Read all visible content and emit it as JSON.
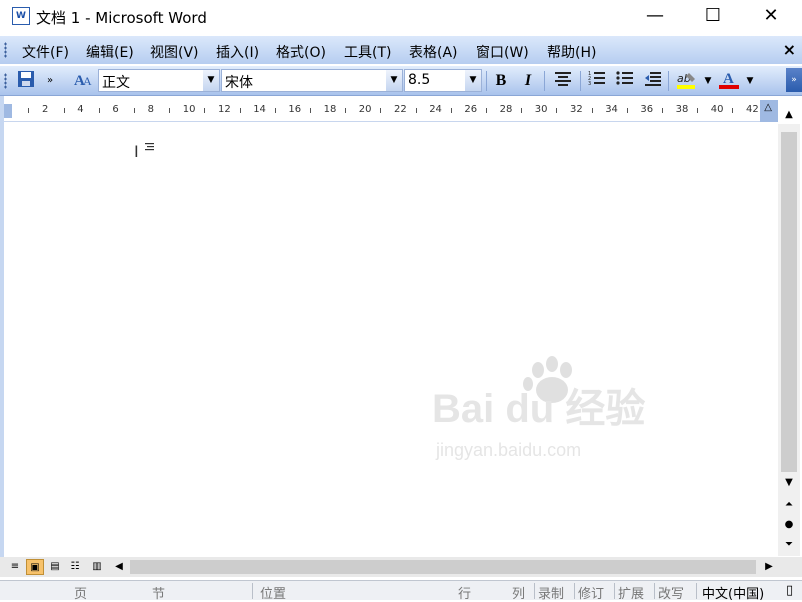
{
  "titlebar": {
    "title": "文档 1 - Microsoft Word",
    "app_icon_letter": "W",
    "minimize": "—",
    "maximize": "☐",
    "close": "✕"
  },
  "menu": {
    "items": [
      "文件(F)",
      "编辑(E)",
      "视图(V)",
      "插入(I)",
      "格式(O)",
      "工具(T)",
      "表格(A)",
      "窗口(W)",
      "帮助(H)"
    ],
    "close": "×"
  },
  "toolbar": {
    "style_value": "正文",
    "font_value": "宋体",
    "size_value": "8.5",
    "bold": "B",
    "italic": "I",
    "font_color": "#e00000",
    "highlight_color": "#ffff00"
  },
  "ruler": {
    "labels": [
      "2",
      "4",
      "6",
      "8",
      "10",
      "12",
      "14",
      "16",
      "18",
      "20",
      "22",
      "24",
      "26",
      "28",
      "30",
      "32",
      "34",
      "36",
      "38",
      "40",
      "42"
    ]
  },
  "statusbar": {
    "page": "页",
    "section": "节",
    "position": "位置",
    "line": "行",
    "column": "列",
    "rec": "录制",
    "trk": "修订",
    "ext": "扩展",
    "ovr": "改写",
    "language": "中文(中国)"
  },
  "watermark": {
    "logo": "Bai du 经验",
    "url": "jingyan.baidu.com"
  },
  "colors": {
    "menubar": "#c9dcf6",
    "toolbar": "#b9cfee",
    "accent": "#2a5cad"
  }
}
